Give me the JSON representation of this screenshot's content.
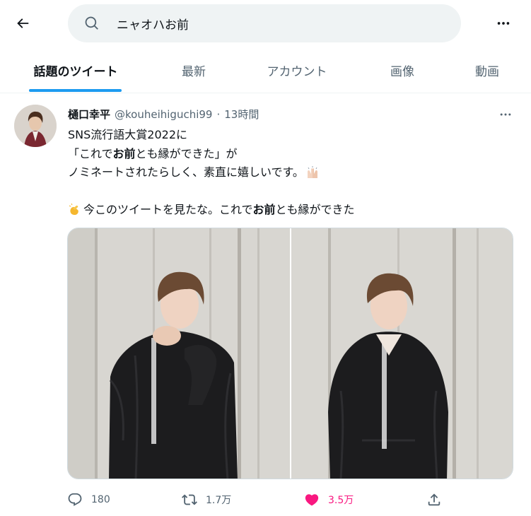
{
  "search": {
    "query": "ニャオハお前"
  },
  "tabs": [
    {
      "label": "話題のツイート",
      "active": true
    },
    {
      "label": "最新",
      "active": false
    },
    {
      "label": "アカウント",
      "active": false
    },
    {
      "label": "画像",
      "active": false
    },
    {
      "label": "動画",
      "active": false
    }
  ],
  "tweet": {
    "author_name": "樋口幸平",
    "handle": "@kouheihiguchi99",
    "separator": "·",
    "time": "13時間",
    "lines": {
      "l1": "SNS流行語大賞2022に",
      "l2_a": "「これで",
      "l2_b": "お前",
      "l2_c": "とも縁ができた」が",
      "l3": "ノミネートされたらしく、素直に嬉しいです。",
      "l4_a": "今このツイートを見たな。これで",
      "l4_b": "お前",
      "l4_c": "とも縁ができた"
    },
    "emojis": [
      "raising-hands-icon",
      "clapping-hands-icon"
    ],
    "stats": {
      "replies": "180",
      "retweets": "1.7万",
      "likes": "3.5万"
    }
  },
  "colors": {
    "accent": "#1d9bf0",
    "like": "#f91880",
    "muted": "#536471",
    "search_bg": "#eff3f4"
  }
}
